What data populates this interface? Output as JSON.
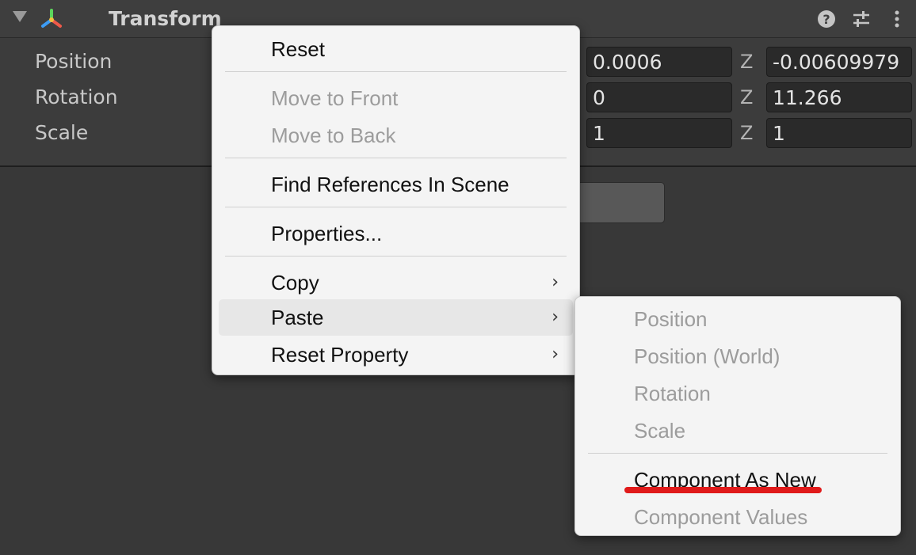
{
  "header": {
    "title": "Transform"
  },
  "properties": [
    {
      "label": "Position",
      "x_value": "0.0006",
      "z_axis": "Z",
      "z_value": "-0.00609979"
    },
    {
      "label": "Rotation",
      "x_value": "0",
      "z_axis": "Z",
      "z_value": "11.266"
    },
    {
      "label": "Scale",
      "x_value": "1",
      "z_axis": "Z",
      "z_value": "1"
    }
  ],
  "context_menu": {
    "items": [
      {
        "label": "Reset",
        "enabled": true
      },
      {
        "label": "Move to Front",
        "enabled": false
      },
      {
        "label": "Move to Back",
        "enabled": false
      },
      {
        "label": "Find References In Scene",
        "enabled": true
      },
      {
        "label": "Properties...",
        "enabled": true
      },
      {
        "label": "Copy",
        "enabled": true,
        "submenu": true
      },
      {
        "label": "Paste",
        "enabled": true,
        "submenu": true,
        "highlighted": true
      },
      {
        "label": "Reset Property",
        "enabled": true,
        "submenu": true
      }
    ],
    "submenu_arrow": "›"
  },
  "paste_submenu": {
    "items": [
      {
        "label": "Position",
        "enabled": false
      },
      {
        "label": "Position (World)",
        "enabled": false
      },
      {
        "label": "Rotation",
        "enabled": false
      },
      {
        "label": "Scale",
        "enabled": false
      },
      {
        "label": "Component As New",
        "enabled": true,
        "underlined": true
      },
      {
        "label": "Component Values",
        "enabled": false
      }
    ]
  },
  "icons": {
    "foldout": "triangle-down-icon",
    "component": "transform-axes-icon",
    "help": "question-circle-icon",
    "presets": "sliders-icon",
    "more": "vertical-ellipsis-icon"
  },
  "colors": {
    "annotation_underline": "#e01a1a",
    "menu_background": "#f4f4f4",
    "disabled_text": "#9c9c9c"
  }
}
